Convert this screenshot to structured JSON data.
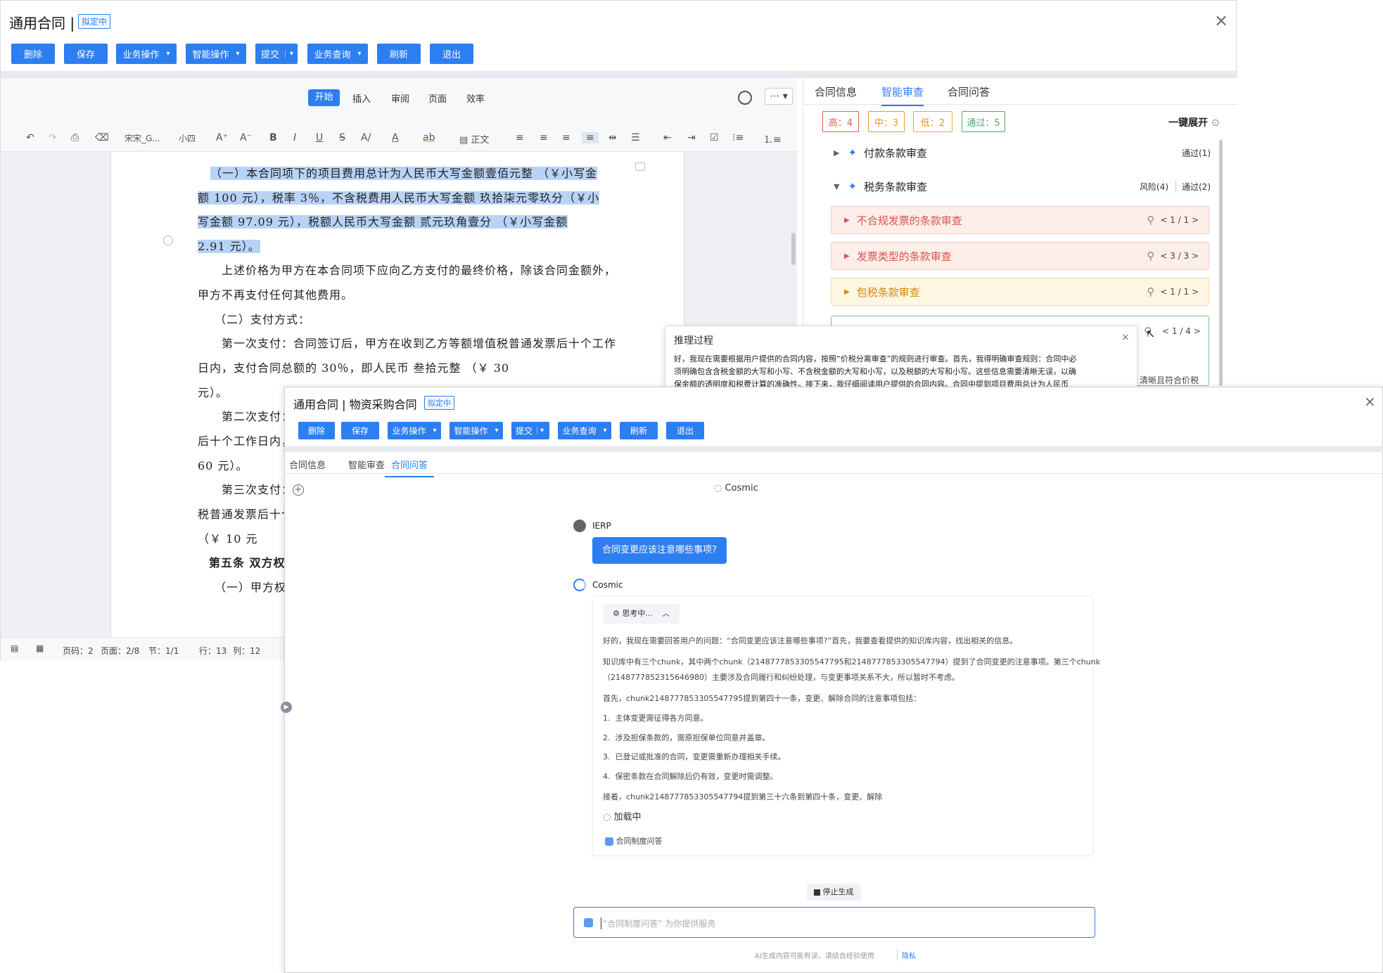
{
  "win1": {
    "title": "通用合同 |",
    "status": "拟定中",
    "close": "×",
    "buttons": [
      "删除",
      "保存",
      "业务操作",
      "智能操作",
      "提交",
      "业务查询",
      "刷新",
      "退出"
    ],
    "editor_tabs": [
      "开始",
      "插入",
      "审阅",
      "页面",
      "效率"
    ],
    "font_name": "宋宋_G...",
    "font_size": "小四",
    "para_style": "正文",
    "doc_lines": [
      {
        "text": "（一）本合同项下的项目费用总计为人民币大写金额壹佰元整 （￥小写金",
        "hl": true
      },
      {
        "text": "额 100 元），税率 3％，不含税费用人民币大写金额 玖拾柒元零玖分（￥小",
        "hl": true
      },
      {
        "text": "写金额 97.09 元），税额人民币大写金额 贰元玖角壹分 （￥小写金额",
        "hl": true
      },
      {
        "text": "2.91 元）。",
        "hl": true
      },
      {
        "text": "上述价格为甲方在本合同项下应向乙方支付的最终价格，除该合同金额外，",
        "hl": false
      },
      {
        "text": "甲方不再支付任何其他费用。",
        "hl": false
      },
      {
        "text": "（二）支付方式：",
        "hl": false
      },
      {
        "text": "第一次支付：合同签订后，甲方在收到乙方等额增值税普通发票后十个工作",
        "hl": false
      },
      {
        "text": "日内，支付合同总额的 30％，即人民币 叁拾元整 （￥ 30",
        "hl": false
      },
      {
        "text": "元）。",
        "hl": false
      },
      {
        "text": "第二次支付：",
        "hl": false
      },
      {
        "text": "后十个工作日内，",
        "hl": false
      },
      {
        "text": "60 元）。",
        "hl": false
      },
      {
        "text": "第三次支付：",
        "hl": false
      },
      {
        "text": "税普通发票后十个",
        "hl": false
      },
      {
        "text": "（￥ 10 元",
        "hl": false
      },
      {
        "text": "第五条 双方权",
        "hl": false
      },
      {
        "text": "（一）甲方权利",
        "hl": false
      }
    ],
    "status_bar": {
      "page": "页码：2",
      "pages": "页面：2/8",
      "section": "节：1/1",
      "row": "行：13",
      "col": "列：12"
    },
    "right_tabs": [
      "合同信息",
      "智能审查",
      "合同问答"
    ],
    "chips": [
      "高：4",
      "中：3",
      "低：2",
      "通过：5"
    ],
    "expand_all": "一键展开",
    "groups": [
      {
        "title": "付款条款审查",
        "right": "通过(1)"
      },
      {
        "title": "税务条款审查",
        "risk": "风险(4)",
        "pass": "通过(2)"
      }
    ],
    "rows": [
      {
        "title": "不合规发票的条款审查",
        "count": "< 1 / 1 >"
      },
      {
        "title": "发票类型的条款审查",
        "count": "< 3 / 3 >"
      },
      {
        "title": "包税条款审查",
        "count": "< 1 / 1 >"
      },
      {
        "title": "",
        "count": "< 1 / 4 >"
      }
    ],
    "partial_text": "清晰且符合价税",
    "popup": {
      "title": "推理过程",
      "close": "×",
      "lines": [
        "好，我现在需要根据用户提供的合同内容，按照“价税分离审查”的规则进行审查。首先，我得明确审查规则：合同中必",
        "须明确包含含税金额的大写和小写、不含税金额的大写和小写，以及税额的大写和小写。这些信息需要清晰无误，以确",
        "保金额的透明度和税费计算的准确性。接下来，我仔细阅读用户提供的合同内容。合同中提到项目费用总计为人民币"
      ]
    }
  },
  "win2": {
    "title": "通用合同 | 物资采购合同",
    "status": "拟定中",
    "close": "×",
    "buttons": [
      "删除",
      "保存",
      "业务操作",
      "智能操作",
      "提交",
      "业务查询",
      "刷新",
      "退出"
    ],
    "tabs": [
      "合同信息",
      "智能审查",
      "合同问答"
    ],
    "bot_name": "Cosmic",
    "user_name": "IERP",
    "user_msg": "合同变更应该注意哪些事项?",
    "thinking": "思考中...",
    "paras": [
      "好的，我现在需要回答用户的问题：“合同变更应该注意哪些事项?”首先，我要查看提供的知识库内容，找出相关的信息。",
      "知识库中有三个chunk，其中两个chunk（2148777853305547795和2148777853305547794）提到了合同变更的注意事项。第三个chunk",
      "（2148777852315646980）主要涉及合同履行和纠纷处理，与变更事项关系不大，所以暂时不考虑。",
      "首先，chunk2148777853305547795提到第四十一条，变更、解除合同的注意事项包括：",
      "1.  主体变更需征得各方同意。",
      "2.  涉及担保条款的，需原担保单位同意并盖章。",
      "3.  已登记或批准的合同，变更需重新办理相关手续。",
      "4.  保密条款在合同解除后仍有效，变更时需调整。",
      "接着，chunk2148777853305547794提到第三十六条到第四十条，变更、解除"
    ],
    "loading": "加载中",
    "tag": "合同制度问答",
    "stop": "停止生成",
    "input_placeholder": "“合同制度问答” 为你提供服务",
    "disclaimer": "AI生成内容可能有误，请结合经验使用",
    "privacy": "隐私"
  },
  "colors": {
    "primary": "#2d7ef0",
    "highlight": "#b9d3f7",
    "high": "#e0604b",
    "mid": "#e8962e",
    "low": "#e0b030",
    "pass": "#52a869"
  }
}
